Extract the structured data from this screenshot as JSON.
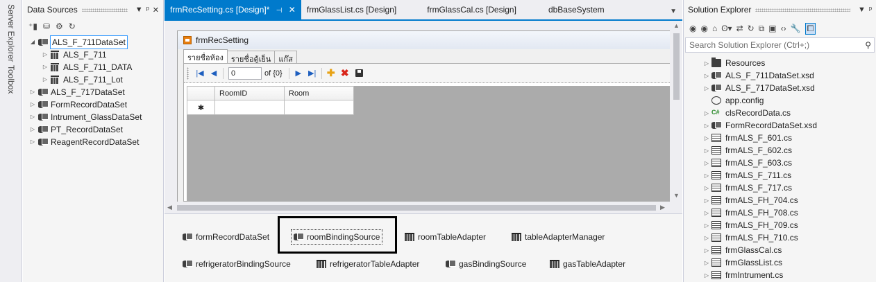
{
  "side_tabs": [
    "Server Explorer",
    "Toolbox"
  ],
  "data_sources": {
    "title": "Data Sources",
    "header_buttons": [
      "▼",
      "ᵖ",
      "✕"
    ],
    "toolbar_icons": [
      "add-data-source-icon",
      "edit-dataset-icon",
      "configure-icon",
      "refresh-icon"
    ],
    "tree": [
      {
        "label": "ALS_F_711DataSet",
        "expanded": true
      },
      {
        "label": "ALS_F_711"
      },
      {
        "label": "ALS_F_711_DATA"
      },
      {
        "label": "ALS_F_711_Lot"
      },
      {
        "label": "ALS_F_717DataSet"
      },
      {
        "label": "FormRecordDataSet"
      },
      {
        "label": "Intrument_GlassDataSet"
      },
      {
        "label": "PT_RecordDataSet"
      },
      {
        "label": "ReagentRecordDataSet"
      }
    ]
  },
  "doc_tabs": [
    {
      "label": "frmRecSetting.cs [Design]*",
      "active": true
    },
    {
      "label": "frmGlassList.cs [Design]"
    },
    {
      "label": "frmGlassCal.cs [Design]"
    },
    {
      "label": "dbBaseSystem"
    }
  ],
  "form": {
    "title": "frmRecSetting",
    "tabs": [
      "รายชื่อห้อง",
      "รายชื่อตู้เย็น",
      "แก๊ส"
    ],
    "navigator": {
      "position": "0",
      "count": "of {0}"
    },
    "grid": {
      "columns": [
        "RoomID",
        "Room"
      ],
      "new_row_marker": "✱"
    }
  },
  "tray": {
    "components": [
      {
        "label": "formRecordDataSet",
        "kind": "dataset"
      },
      {
        "label": "roomBindingSource",
        "kind": "binding",
        "selected": true
      },
      {
        "label": "roomTableAdapter",
        "kind": "adapter"
      },
      {
        "label": "tableAdapterManager",
        "kind": "adapter"
      },
      {
        "label": "refrigeratorBindingSource",
        "kind": "binding"
      },
      {
        "label": "refrigeratorTableAdapter",
        "kind": "adapter"
      },
      {
        "label": "gasBindingSource",
        "kind": "binding"
      },
      {
        "label": "gasTableAdapter",
        "kind": "adapter"
      }
    ]
  },
  "solution_explorer": {
    "title": "Solution Explorer",
    "search_placeholder": "Search Solution Explorer (Ctrl+;)",
    "items": [
      {
        "label": "Resources",
        "icon": "folder"
      },
      {
        "label": "ALS_F_711DataSet.xsd",
        "icon": "dataset"
      },
      {
        "label": "ALS_F_717DataSet.xsd",
        "icon": "dataset"
      },
      {
        "label": "app.config",
        "icon": "config"
      },
      {
        "label": "clsRecordData.cs",
        "icon": "csharp"
      },
      {
        "label": "FormRecordDataSet.xsd",
        "icon": "dataset"
      },
      {
        "label": "frmALS_F_601.cs",
        "icon": "form"
      },
      {
        "label": "frmALS_F_602.cs",
        "icon": "form"
      },
      {
        "label": "frmALS_F_603.cs",
        "icon": "form"
      },
      {
        "label": "frmALS_F_711.cs",
        "icon": "form"
      },
      {
        "label": "frmALS_F_717.cs",
        "icon": "form"
      },
      {
        "label": "frmALS_FH_704.cs",
        "icon": "form"
      },
      {
        "label": "frmALS_FH_708.cs",
        "icon": "form"
      },
      {
        "label": "frmALS_FH_709.cs",
        "icon": "form"
      },
      {
        "label": "frmALS_FH_710.cs",
        "icon": "form"
      },
      {
        "label": "frmGlassCal.cs",
        "icon": "form"
      },
      {
        "label": "frmGlassList.cs",
        "icon": "form"
      },
      {
        "label": "frmIntrument.cs",
        "icon": "form"
      }
    ]
  },
  "colors": {
    "accent": "#007ACC",
    "panel": "#F5F5F5",
    "grid_bg": "#ABABAB"
  }
}
